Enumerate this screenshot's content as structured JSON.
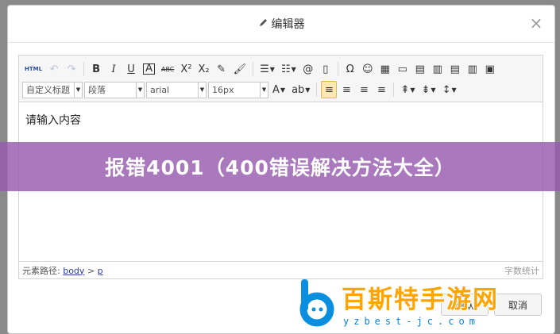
{
  "dialog": {
    "title": "编辑器",
    "close_glyph": "×"
  },
  "toolbar": {
    "row1": [
      {
        "name": "source-html-button",
        "label": "HTML",
        "small": true
      },
      {
        "name": "undo-button",
        "label": "↶",
        "dim": true
      },
      {
        "name": "redo-button",
        "label": "↷",
        "dim": true
      },
      {
        "sep": true
      },
      {
        "name": "bold-button",
        "label": "B",
        "bold": true
      },
      {
        "name": "italic-button",
        "label": "I",
        "italic": true
      },
      {
        "name": "underline-button",
        "label": "U",
        "underline": true
      },
      {
        "name": "font-border-button",
        "label": "A",
        "boxed": true
      },
      {
        "name": "strikethrough-button",
        "label": "ABC",
        "strike": true
      },
      {
        "name": "superscript-button",
        "label": "X²"
      },
      {
        "name": "subscript-button",
        "label": "X₂"
      },
      {
        "name": "eraser-button",
        "label": "✎"
      },
      {
        "name": "format-painter-button",
        "label": "🖌"
      },
      {
        "sep": true
      },
      {
        "name": "ordered-list-button",
        "label": "☰",
        "caret": true
      },
      {
        "name": "unordered-list-button",
        "label": "☷",
        "caret": true
      },
      {
        "name": "insert-anchor-button",
        "label": "@"
      },
      {
        "name": "insert-page-button",
        "label": "▯"
      },
      {
        "sep": true
      },
      {
        "name": "special-char-button",
        "label": "Ω"
      },
      {
        "name": "emotion-button",
        "label": "☺"
      },
      {
        "name": "insert-table-button",
        "label": "▦"
      },
      {
        "name": "insert-image-button",
        "label": "▭"
      },
      {
        "name": "table-row-button",
        "label": "▤"
      },
      {
        "name": "table-col-button",
        "label": "▥"
      },
      {
        "name": "table-merge-button",
        "label": "▤"
      },
      {
        "name": "table-split-button",
        "label": "▥"
      },
      {
        "name": "preview-button",
        "label": "▣"
      }
    ],
    "selects": {
      "heading": "自定义标题",
      "paragraph": "段落",
      "font_family": "arial",
      "font_size": "16px"
    },
    "row2_buttons": [
      {
        "name": "font-color-button",
        "label": "A",
        "caret": true
      },
      {
        "name": "highlight-button",
        "label": "ab",
        "caret": true
      },
      {
        "sep": true
      },
      {
        "name": "align-left-button",
        "label": "≡",
        "active": true
      },
      {
        "name": "align-center-button",
        "label": "≡"
      },
      {
        "name": "align-right-button",
        "label": "≡"
      },
      {
        "name": "align-justify-button",
        "label": "≡"
      },
      {
        "sep": true
      },
      {
        "name": "row-spacing-top-button",
        "label": "⇞",
        "caret": true
      },
      {
        "name": "row-spacing-bottom-button",
        "label": "⇟",
        "caret": true
      },
      {
        "name": "line-height-button",
        "label": "↕",
        "caret": true
      }
    ]
  },
  "content": {
    "placeholder": "请输入内容"
  },
  "statusbar": {
    "path_label": "元素路径:",
    "path_body": "body",
    "path_sep": ">",
    "path_p": "p",
    "wordcount": "字数统计"
  },
  "banner": {
    "text": "报错4001（400错误解决方法大全）"
  },
  "footer": {
    "confirm_label": "确认",
    "cancel_label": "取消"
  },
  "watermark": {
    "brand": "百斯特手游网",
    "url": "yzbest-jc.com"
  }
}
